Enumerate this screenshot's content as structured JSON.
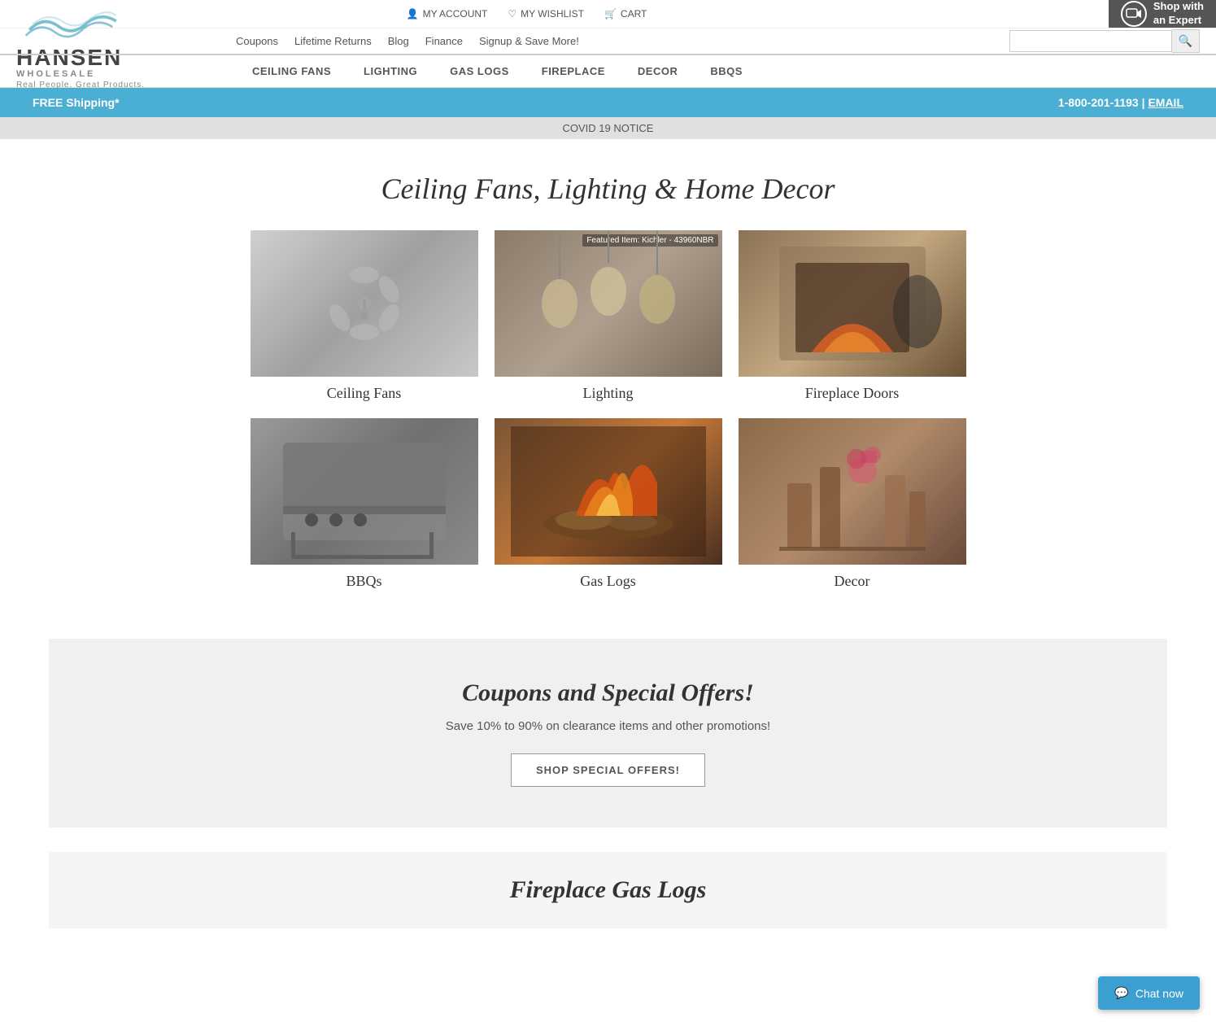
{
  "site": {
    "name": "HANSEN",
    "subtitle": "WHOLESALE",
    "tagline": "Real People. Great Products.",
    "logo_wave_color": "#5ba8c8"
  },
  "top_nav": {
    "my_account": "MY ACCOUNT",
    "my_wishlist": "MY WISHLIST",
    "cart": "CART",
    "shop_expert": "Shop with\nan Expert"
  },
  "secondary_nav": {
    "links": [
      {
        "label": "Coupons",
        "href": "#"
      },
      {
        "label": "Lifetime Returns",
        "href": "#"
      },
      {
        "label": "Blog",
        "href": "#"
      },
      {
        "label": "Finance",
        "href": "#"
      },
      {
        "label": "Signup & Save More!",
        "href": "#"
      }
    ],
    "search_placeholder": ""
  },
  "main_nav": {
    "items": [
      {
        "label": "CEILING FANS"
      },
      {
        "label": "LIGHTING"
      },
      {
        "label": "GAS LOGS"
      },
      {
        "label": "FIREPLACE"
      },
      {
        "label": "DECOR"
      },
      {
        "label": "BBQS"
      }
    ]
  },
  "info_bar": {
    "shipping": "FREE Shipping*",
    "phone": "1-800-201-1193",
    "separator": "|",
    "email": "EMAIL"
  },
  "covid_bar": {
    "text": "COVID 19 NOTICE"
  },
  "hero": {
    "heading": "Ceiling Fans, Lighting & Home Decor"
  },
  "products": [
    {
      "label": "Ceiling Fans",
      "featured": "",
      "img_class": "img-ceiling"
    },
    {
      "label": "Lighting",
      "featured": "Featured Item: Kichler - 43960NBR",
      "img_class": "img-lighting"
    },
    {
      "label": "Fireplace Doors",
      "featured": "",
      "img_class": "img-fireplace-door"
    },
    {
      "label": "BBQs",
      "featured": "",
      "img_class": "img-bbq"
    },
    {
      "label": "Gas Logs",
      "featured": "",
      "img_class": "img-gas-logs"
    },
    {
      "label": "Decor",
      "featured": "",
      "img_class": "img-decor"
    }
  ],
  "coupons": {
    "title": "Coupons and Special Offers!",
    "subtitle": "Save 10% to 90% on clearance items and other promotions!",
    "button": "SHOP SPECIAL OFFERS!"
  },
  "fireplace_section": {
    "title": "Fireplace Gas Logs"
  },
  "chat": {
    "label": "Chat now"
  }
}
